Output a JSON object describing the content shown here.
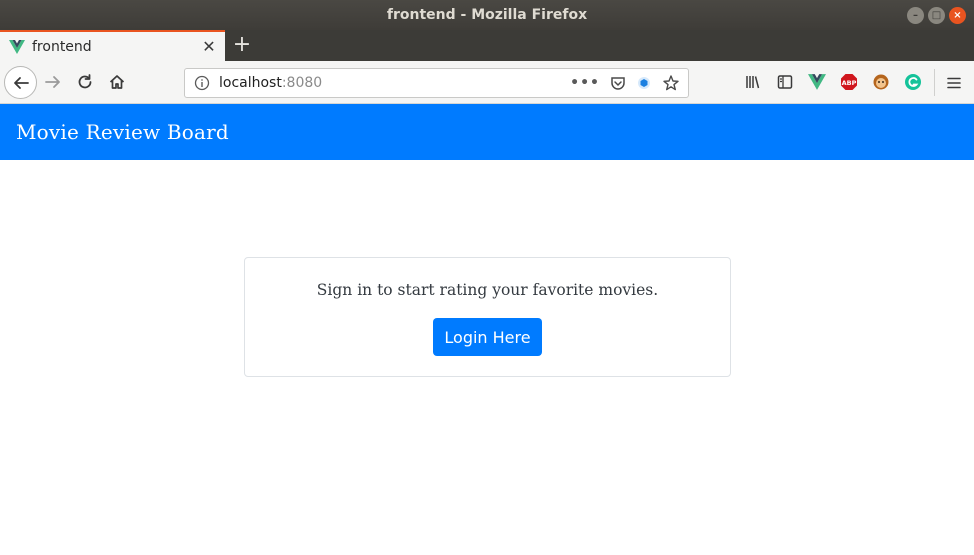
{
  "window": {
    "title": "frontend - Mozilla Firefox"
  },
  "tabs": [
    {
      "label": "frontend",
      "favicon": "vue-logo-icon"
    }
  ],
  "navigation": {
    "url_host": "localhost",
    "url_port": ":8080"
  },
  "colors": {
    "brand_primary": "#007bff",
    "tab_accent": "#e95420"
  },
  "app": {
    "brand": "Movie Review Board"
  },
  "signin_card": {
    "message": "Sign in to start rating your favorite movies.",
    "button_label": "Login Here"
  }
}
